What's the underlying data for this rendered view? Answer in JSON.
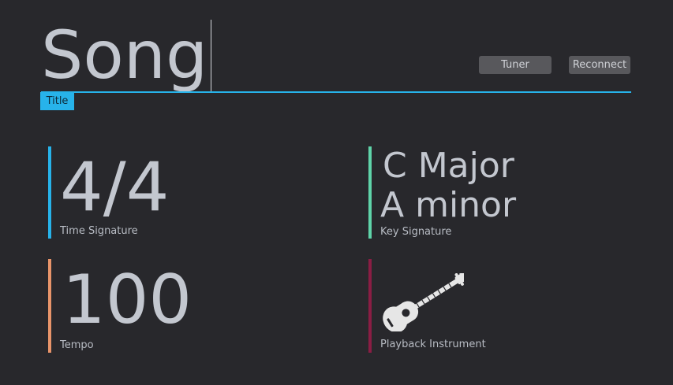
{
  "title": {
    "value": "Song",
    "tag_label": "Title"
  },
  "toolbar": {
    "tuner_label": "Tuner",
    "reconnect_label": "Reconnect"
  },
  "tiles": {
    "time_signature": {
      "value": "4/4",
      "label": "Time Signature",
      "accent": "#27b3ea"
    },
    "key_signature": {
      "major": "C Major",
      "minor": "A minor",
      "label": "Key Signature",
      "accent": "#5fd4a9"
    },
    "tempo": {
      "value": "100",
      "label": "Tempo",
      "accent": "#e8946a"
    },
    "playback_instrument": {
      "icon": "acoustic-guitar-icon",
      "label": "Playback Instrument",
      "accent": "#8a1d44"
    }
  }
}
